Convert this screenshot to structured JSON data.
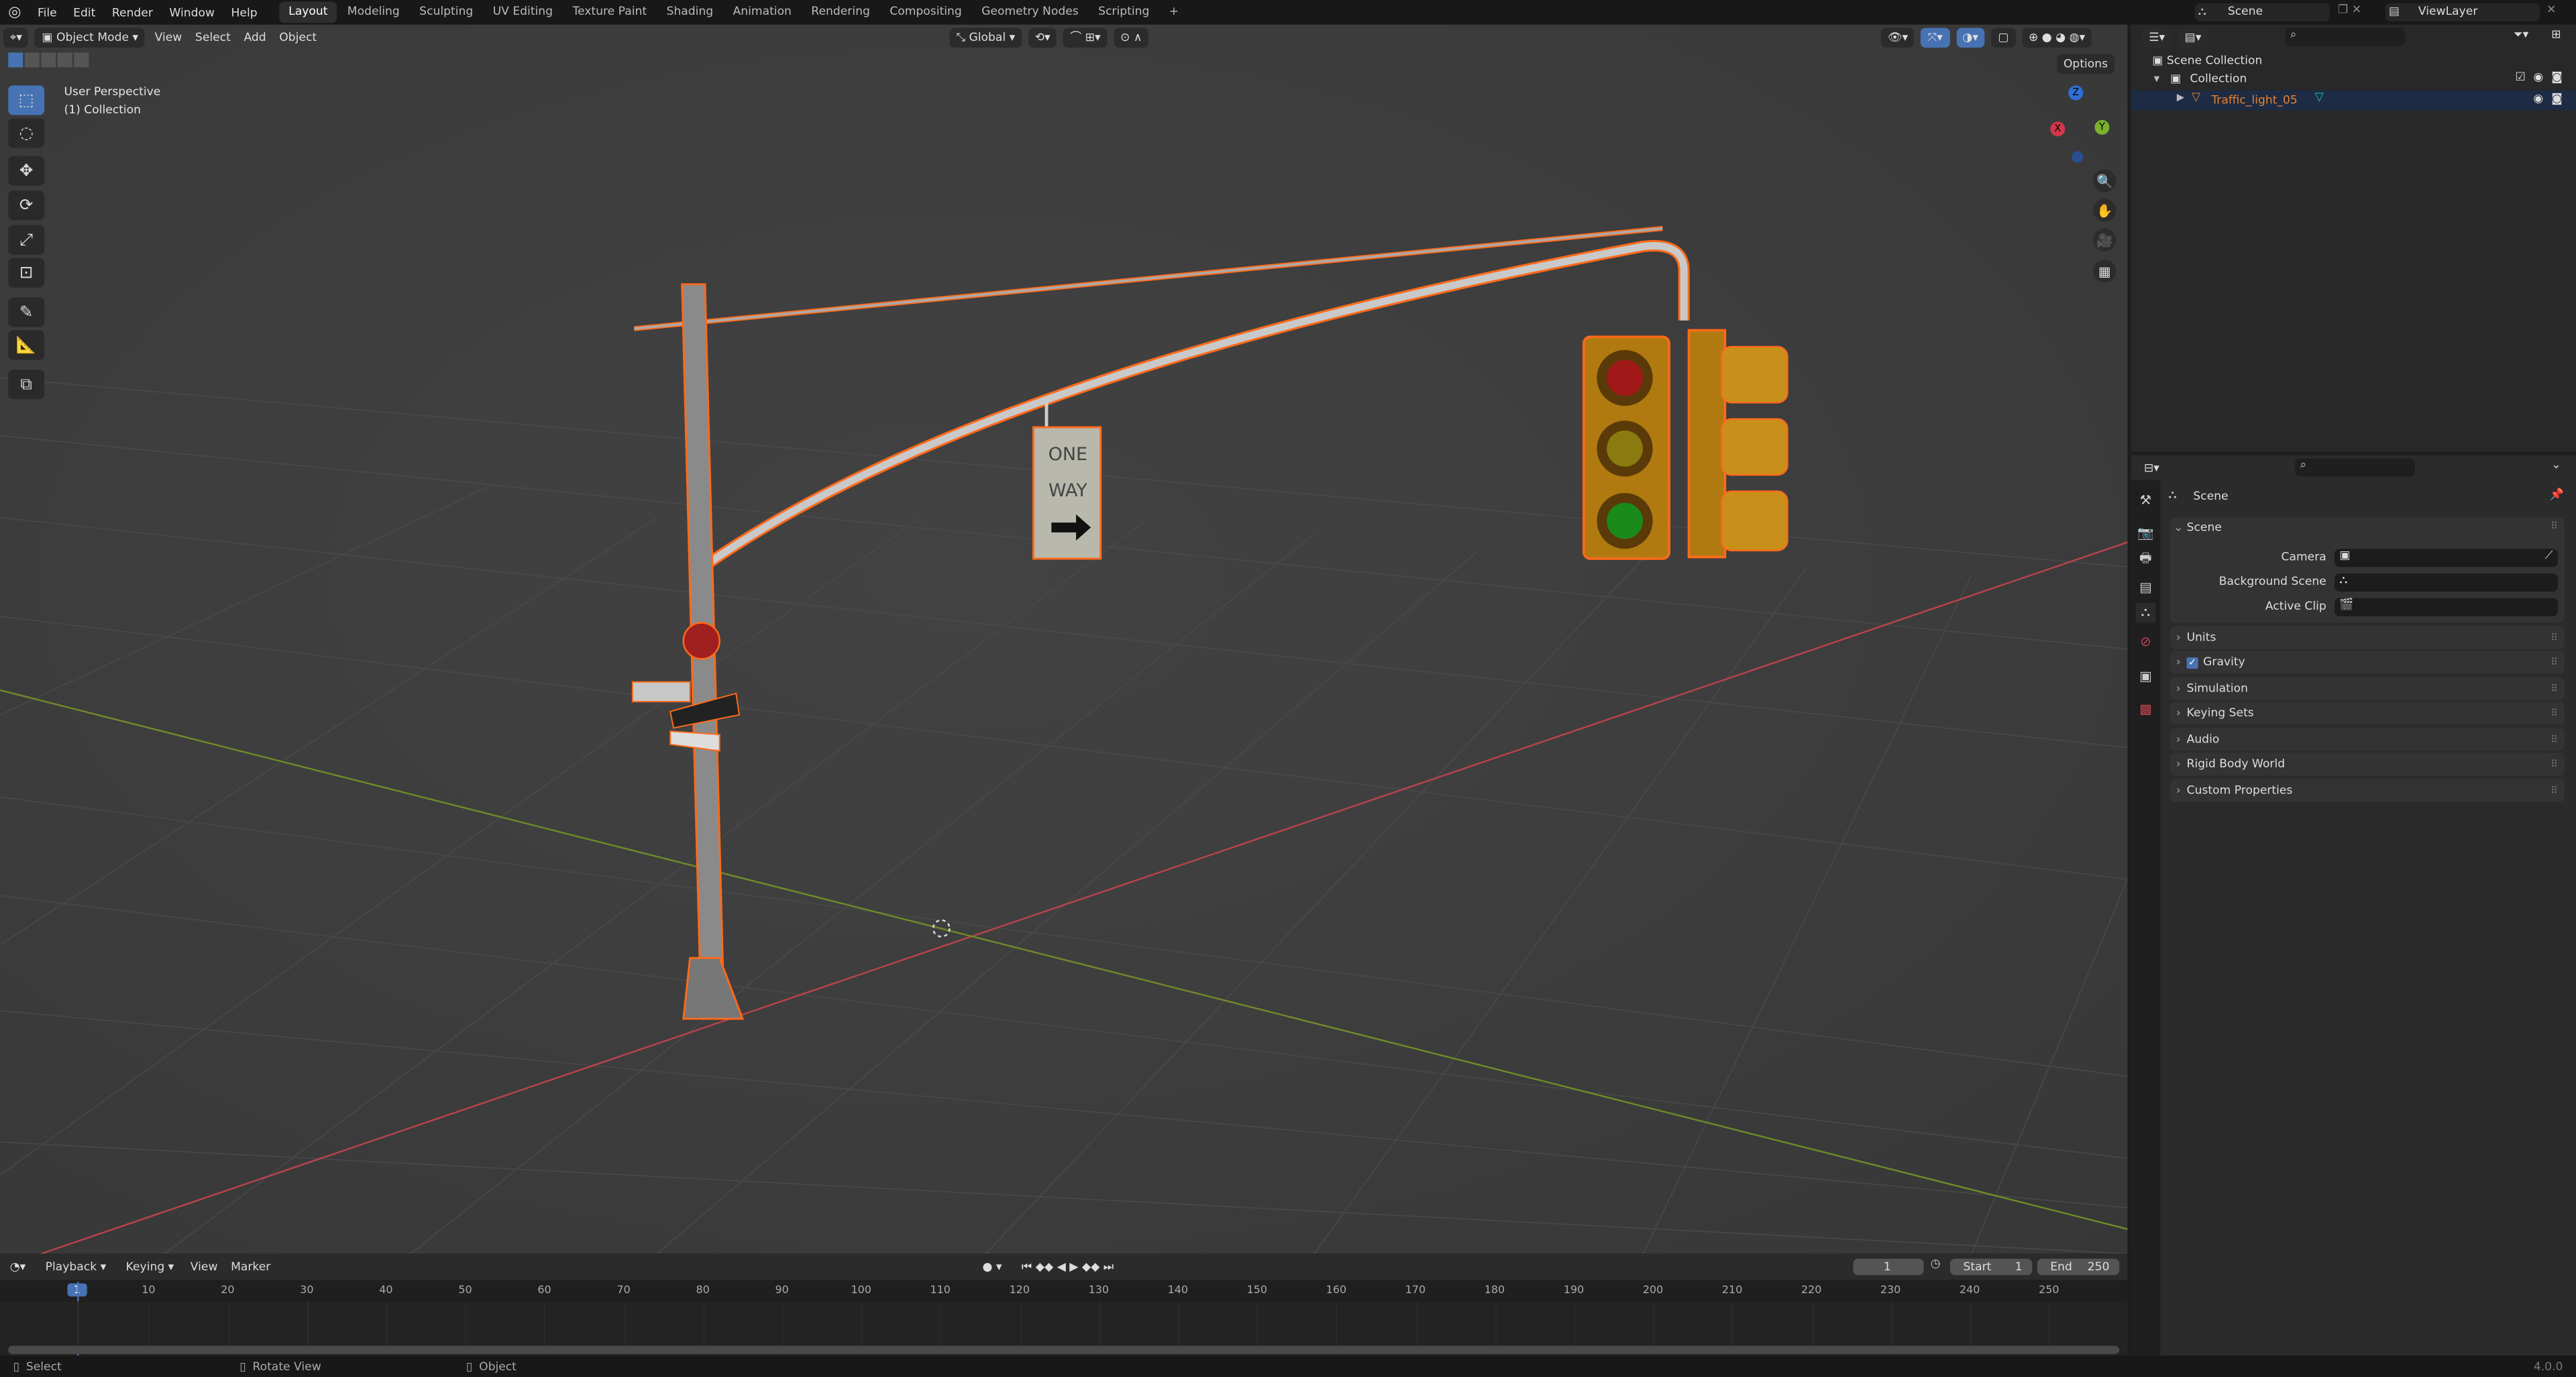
{
  "menu": [
    "File",
    "Edit",
    "Render",
    "Window",
    "Help"
  ],
  "workspaces": [
    "Layout",
    "Modeling",
    "Sculpting",
    "UV Editing",
    "Texture Paint",
    "Shading",
    "Animation",
    "Rendering",
    "Compositing",
    "Geometry Nodes",
    "Scripting",
    "+"
  ],
  "active_workspace": "Layout",
  "scene_selector": {
    "scene": "Scene",
    "view_layer": "ViewLayer"
  },
  "viewport": {
    "mode": "Object Mode",
    "menus": [
      "View",
      "Select",
      "Add",
      "Object"
    ],
    "transform_orientation": "Global",
    "options": "Options",
    "overlay_title": "User Perspective",
    "overlay_collection": "(1) Collection",
    "gizmo": {
      "x": "X",
      "y": "Y",
      "z": "Z"
    },
    "sign_text": [
      "ONE",
      "WAY"
    ]
  },
  "outliner": {
    "root": "Scene Collection",
    "collection": "Collection",
    "object": "Traffic_light_05"
  },
  "properties": {
    "title": "Scene",
    "section": "Scene",
    "fields": [
      {
        "label": "Camera"
      },
      {
        "label": "Background Scene"
      },
      {
        "label": "Active Clip"
      }
    ],
    "panels": [
      "Units",
      "Gravity",
      "Simulation",
      "Keying Sets",
      "Audio",
      "Rigid Body World",
      "Custom Properties"
    ],
    "gravity_checked": true
  },
  "timeline": {
    "menus": [
      "Playback",
      "Keying",
      "View",
      "Marker"
    ],
    "current_frame": "1",
    "start_label": "Start",
    "start": "1",
    "end_label": "End",
    "end": "250",
    "ticks": [
      "1",
      "10",
      "20",
      "30",
      "40",
      "50",
      "60",
      "70",
      "80",
      "90",
      "100",
      "110",
      "120",
      "130",
      "140",
      "150",
      "160",
      "170",
      "180",
      "190",
      "200",
      "210",
      "220",
      "230",
      "240",
      "250"
    ]
  },
  "status": {
    "select": "Select",
    "rotate": "Rotate View",
    "object": "Object",
    "version": "4.0.0"
  },
  "colors": {
    "accent": "#4772b3",
    "selection": "#ff6a1a",
    "x_axis": "#c8424f",
    "y_axis": "#7a9a2a",
    "object_text": "#e8822c"
  }
}
